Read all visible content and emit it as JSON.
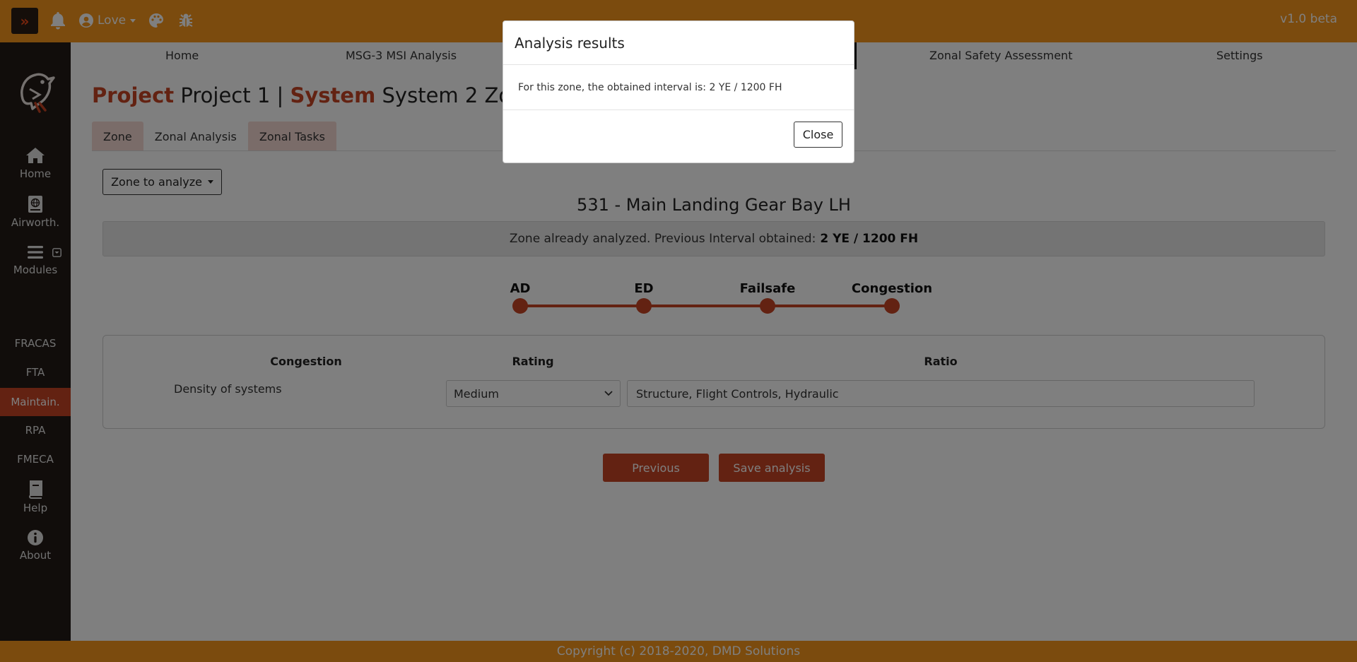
{
  "topbar": {
    "expand_glyph": "»",
    "user_name": "Love",
    "version": "v1.0 beta",
    "icons": [
      "bell-icon",
      "user-circle-icon",
      "palette-icon",
      "bug-icon"
    ]
  },
  "sidebar": {
    "items": [
      {
        "label": "Home",
        "icon": "home-icon"
      },
      {
        "label": "Airworth.",
        "icon": "book-globe-icon"
      },
      {
        "label": "Modules",
        "icon": "bars-icon"
      },
      {
        "label": "FRACAS"
      },
      {
        "label": "FTA"
      },
      {
        "label": "Maintain."
      },
      {
        "label": "RPA"
      },
      {
        "label": "FMECA"
      },
      {
        "label": "Help",
        "icon": "book-icon"
      },
      {
        "label": "About",
        "icon": "info-icon"
      }
    ],
    "active": "Maintain."
  },
  "topnav": {
    "items": [
      "Home",
      "MSG-3 MSI Analysis",
      "Zonal Safety Assessment",
      "Settings"
    ]
  },
  "page": {
    "title_project_label": "Project",
    "title_project_value": "Project 1 |",
    "title_system_label": "System",
    "title_system_value": "System 2 Zona"
  },
  "tabs": [
    "Zone",
    "Zonal Analysis",
    "Zonal Tasks"
  ],
  "zone_dropdown": {
    "label": "Zone to analyze"
  },
  "zone": {
    "title": "531 - Main Landing Gear Bay LH",
    "notice_prefix": "Zone already analyzed. Previous Interval obtained:",
    "notice_value": "2 YE / 1200 FH"
  },
  "stepper": {
    "steps": [
      "AD",
      "ED",
      "Failsafe",
      "Congestion"
    ]
  },
  "table": {
    "headers": [
      "Congestion",
      "Rating",
      "Ratio"
    ],
    "row": {
      "label": "Density of systems",
      "rating": "Medium",
      "ratio": "Structure, Flight Controls, Hydraulic"
    }
  },
  "buttons": {
    "previous": "Previous",
    "save": "Save analysis"
  },
  "footer": {
    "text": "Copyright (c) 2018-2020, DMD Solutions"
  },
  "modal": {
    "title": "Analysis results",
    "body": "For this zone, the obtained interval is: 2 YE / 1200 FH",
    "close": "Close"
  },
  "colors": {
    "topbar": "#f7961c",
    "accent": "#c64424",
    "sidebar": "#231a16"
  }
}
